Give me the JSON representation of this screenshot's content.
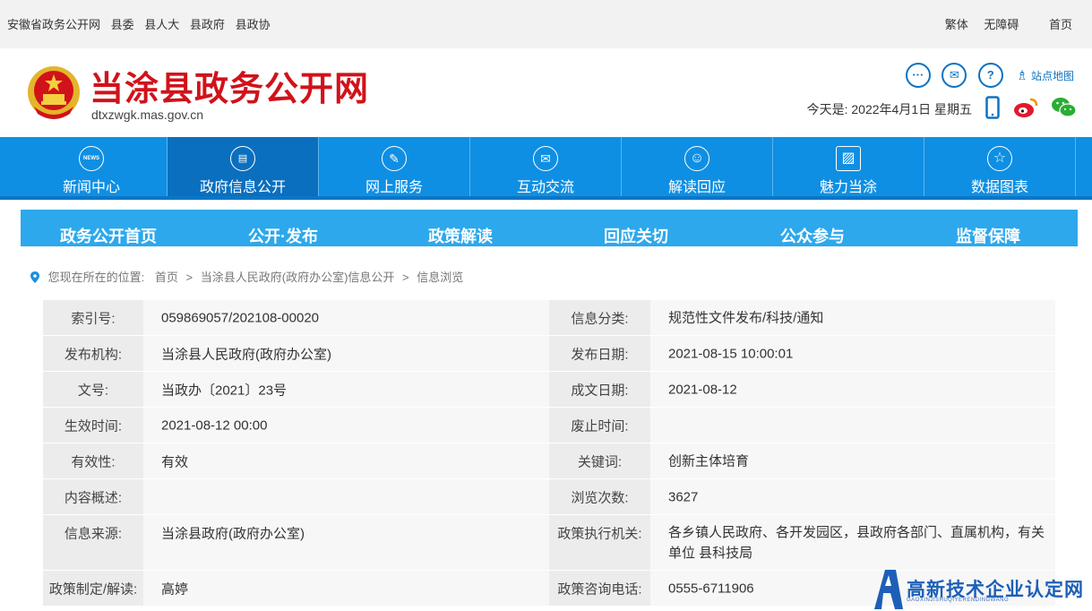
{
  "topbar": {
    "left_links": [
      "安徽省政务公开网",
      "县委",
      "县人大",
      "县政府",
      "县政协"
    ],
    "right_links": [
      "繁体",
      "无障碍",
      "首页"
    ]
  },
  "header": {
    "title": "当涂县政务公开网",
    "domain": "dtxzwgk.mas.gov.cn",
    "icons": [
      "chat-icon",
      "mail-icon",
      "help-icon"
    ],
    "sitemap_label": "站点地图",
    "date_prefix": "今天是:",
    "date_value": "2022年4月1日 星期五"
  },
  "nav": {
    "items": [
      {
        "label": "新闻中心",
        "icon": "news-icon",
        "glyph": "NEWS"
      },
      {
        "label": "政府信息公开",
        "icon": "document-icon",
        "glyph": "▤"
      },
      {
        "label": "网上服务",
        "icon": "pencil-icon",
        "glyph": "✎"
      },
      {
        "label": "互动交流",
        "icon": "envelope-icon",
        "glyph": "✉"
      },
      {
        "label": "解读回应",
        "icon": "smile-icon",
        "glyph": "☺"
      },
      {
        "label": "魅力当涂",
        "icon": "picture-icon",
        "glyph": "▨"
      },
      {
        "label": "数据图表",
        "icon": "star-icon",
        "glyph": "☆"
      }
    ],
    "active_index": 1
  },
  "subnav": {
    "items": [
      "政务公开首页",
      "公开·发布",
      "政策解读",
      "回应关切",
      "公众参与",
      "监督保障"
    ]
  },
  "breadcrumb": {
    "prefix": "您现在所在的位置:",
    "items": [
      "首页",
      "当涂县人民政府(政府办公室)信息公开",
      "信息浏览"
    ]
  },
  "info": {
    "rows": [
      {
        "l1": "索引号:",
        "v1": "059869057/202108-00020",
        "l2": "信息分类:",
        "v2": "规范性文件发布/科技/通知"
      },
      {
        "l1": "发布机构:",
        "v1": "当涂县人民政府(政府办公室)",
        "l2": "发布日期:",
        "v2": "2021-08-15 10:00:01"
      },
      {
        "l1": "文号:",
        "v1": "当政办〔2021〕23号",
        "l2": "成文日期:",
        "v2": "2021-08-12"
      },
      {
        "l1": "生效时间:",
        "v1": "2021-08-12 00:00",
        "l2": "废止时间:",
        "v2": ""
      },
      {
        "l1": "有效性:",
        "v1": "有效",
        "l2": "关键词:",
        "v2": "创新主体培育"
      },
      {
        "l1": "内容概述:",
        "v1": "",
        "l2": "浏览次数:",
        "v2": "3627"
      },
      {
        "l1": "信息来源:",
        "v1": "当涂县政府(政府办公室)",
        "l2": "政策执行机关:",
        "v2": "各乡镇人民政府、各开发园区，县政府各部门、直属机构，有关单位 县科技局"
      },
      {
        "l1": "政策制定/解读:",
        "v1": "高婷",
        "l2": "政策咨询电话:",
        "v2": "0555-6711906"
      }
    ]
  },
  "watermark": {
    "text": "高新技术企业认定网",
    "sub": "GAOXINJISHUQIYERENDINGWANG"
  },
  "colors": {
    "title_red": "#d1121a",
    "nav_blue": "#0f8fe3",
    "nav_active": "#0a6fbf",
    "subnav_blue": "#2da8ec",
    "icon_blue": "#0c73c2"
  }
}
